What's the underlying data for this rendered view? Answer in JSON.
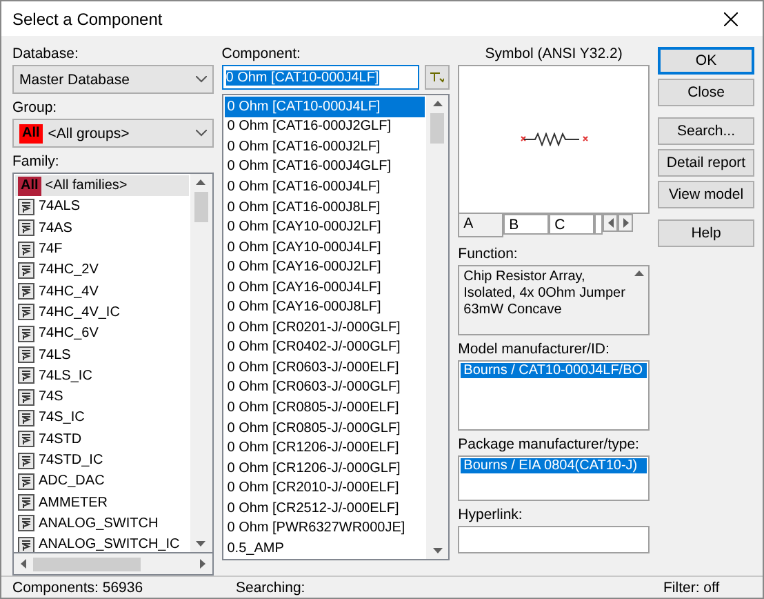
{
  "window": {
    "title": "Select a Component"
  },
  "database": {
    "label": "Database:",
    "value": "Master Database"
  },
  "group": {
    "label": "Group:",
    "badge": "All",
    "value": "<All groups>"
  },
  "family": {
    "label": "Family:",
    "items": [
      {
        "label": "<All families>",
        "kind": "all",
        "badge": "All",
        "selected": true
      },
      {
        "label": "74ALS",
        "kind": "chip",
        "selected": false
      },
      {
        "label": "74AS",
        "kind": "chip",
        "selected": false
      },
      {
        "label": "74F",
        "kind": "chip",
        "selected": false
      },
      {
        "label": "74HC_2V",
        "kind": "chip",
        "selected": false
      },
      {
        "label": "74HC_4V",
        "kind": "chip",
        "selected": false
      },
      {
        "label": "74HC_4V_IC",
        "kind": "chip",
        "selected": false
      },
      {
        "label": "74HC_6V",
        "kind": "chip",
        "selected": false
      },
      {
        "label": "74LS",
        "kind": "chip",
        "selected": false
      },
      {
        "label": "74LS_IC",
        "kind": "chip",
        "selected": false
      },
      {
        "label": "74S",
        "kind": "chip",
        "selected": false
      },
      {
        "label": "74S_IC",
        "kind": "chip",
        "selected": false
      },
      {
        "label": "74STD",
        "kind": "chip",
        "selected": false
      },
      {
        "label": "74STD_IC",
        "kind": "chip",
        "selected": false
      },
      {
        "label": "ADC_DAC",
        "kind": "chip",
        "selected": false
      },
      {
        "label": "AMMETER",
        "kind": "chip",
        "selected": false
      },
      {
        "label": "ANALOG_SWITCH",
        "kind": "chip",
        "selected": false
      },
      {
        "label": "ANALOG_SWITCH_IC",
        "kind": "chip",
        "selected": false
      }
    ]
  },
  "component": {
    "label": "Component:",
    "value": "0 Ohm  [CAT10-000J4LF]",
    "items": [
      {
        "label": "0 Ohm  [CAT10-000J4LF]",
        "selected": true
      },
      {
        "label": "0 Ohm  [CAT16-000J2GLF]",
        "selected": false
      },
      {
        "label": "0 Ohm  [CAT16-000J2LF]",
        "selected": false
      },
      {
        "label": "0 Ohm  [CAT16-000J4GLF]",
        "selected": false
      },
      {
        "label": "0 Ohm  [CAT16-000J4LF]",
        "selected": false
      },
      {
        "label": "0 Ohm  [CAT16-000J8LF]",
        "selected": false
      },
      {
        "label": "0 Ohm  [CAY10-000J2LF]",
        "selected": false
      },
      {
        "label": "0 Ohm  [CAY10-000J4LF]",
        "selected": false
      },
      {
        "label": "0 Ohm  [CAY16-000J2LF]",
        "selected": false
      },
      {
        "label": "0 Ohm  [CAY16-000J4LF]",
        "selected": false
      },
      {
        "label": "0 Ohm  [CAY16-000J8LF]",
        "selected": false
      },
      {
        "label": "0 Ohm  [CR0201-J/-000GLF]",
        "selected": false
      },
      {
        "label": "0 Ohm  [CR0402-J/-000GLF]",
        "selected": false
      },
      {
        "label": "0 Ohm  [CR0603-J/-000ELF]",
        "selected": false
      },
      {
        "label": "0 Ohm  [CR0603-J/-000GLF]",
        "selected": false
      },
      {
        "label": "0 Ohm  [CR0805-J/-000ELF]",
        "selected": false
      },
      {
        "label": "0 Ohm  [CR0805-J/-000GLF]",
        "selected": false
      },
      {
        "label": "0 Ohm  [CR1206-J/-000ELF]",
        "selected": false
      },
      {
        "label": "0 Ohm  [CR1206-J/-000GLF]",
        "selected": false
      },
      {
        "label": "0 Ohm  [CR2010-J/-000ELF]",
        "selected": false
      },
      {
        "label": "0 Ohm  [CR2512-J/-000ELF]",
        "selected": false
      },
      {
        "label": "0 Ohm  [PWR6327WR000JE]",
        "selected": false
      },
      {
        "label": "0.5_AMP",
        "selected": false
      }
    ]
  },
  "symbol": {
    "label": "Symbol (ANSI Y32.2)",
    "tabs": [
      {
        "label": "A",
        "selected": true
      },
      {
        "label": "B",
        "selected": false
      },
      {
        "label": "C",
        "selected": false
      }
    ]
  },
  "function": {
    "label": "Function:",
    "text": "Chip Resistor Array, Isolated, 4x 0Ohm Jumper 63mW Concave"
  },
  "model": {
    "label": "Model manufacturer/ID:",
    "items": [
      {
        "label": "Bourns / CAT10-000J4LF/BO",
        "selected": true
      }
    ]
  },
  "package": {
    "label": "Package manufacturer/type:",
    "items": [
      {
        "label": "Bourns / EIA 0804(CAT10-J)",
        "selected": true
      }
    ]
  },
  "hyperlink": {
    "label": "Hyperlink:"
  },
  "buttons": [
    {
      "label": "OK",
      "kind": "default"
    },
    {
      "label": "Close",
      "kind": "normal"
    },
    {
      "label": "Search...",
      "kind": "gap"
    },
    {
      "label": "Detail report",
      "kind": "normal"
    },
    {
      "label": "View model",
      "kind": "normal"
    },
    {
      "label": "Help",
      "kind": "gap"
    }
  ],
  "status_bar": {
    "components": "Components: 56936",
    "searching": "Searching:",
    "filter": "Filter: off"
  }
}
